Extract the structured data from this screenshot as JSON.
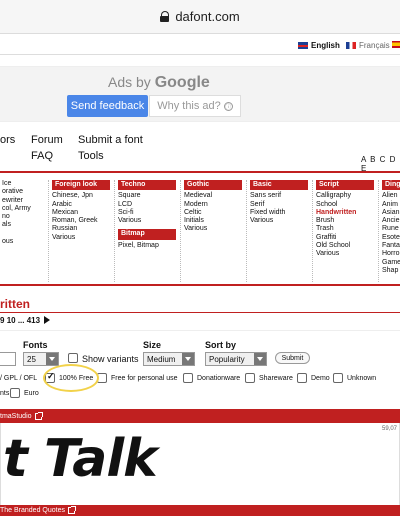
{
  "browser": {
    "url": "dafont.com"
  },
  "languages": {
    "english": "English",
    "francais": "Français"
  },
  "ads": {
    "ads_by": "Ads by",
    "google": "Google",
    "feedback_button": "Send feedback",
    "why_button": "Why this ad?",
    "info_glyph": "ⓘ"
  },
  "nav": {
    "authors": "ors",
    "forum": "Forum",
    "submit": "Submit a font",
    "faq": "FAQ",
    "tools": "Tools",
    "alphabet": "A B C D E"
  },
  "categories": {
    "fancy_partial": [
      "Ice",
      "orative",
      "ewriter",
      "col, Army",
      "no",
      "als",
      "",
      "ous"
    ],
    "foreign": {
      "title": "Foreign look",
      "items": [
        "Chinese, Jpn",
        "Arabic",
        "Mexican",
        "Roman, Greek",
        "Russian",
        "Various"
      ]
    },
    "techno": {
      "title": "Techno",
      "items": [
        "Square",
        "LCD",
        "Sci-fi",
        "Various"
      ]
    },
    "bitmap": {
      "title": "Bitmap",
      "items": [
        "Pixel, Bitmap"
      ]
    },
    "gothic": {
      "title": "Gothic",
      "items": [
        "Medieval",
        "Modern",
        "Celtic",
        "Initials",
        "Various"
      ]
    },
    "basic": {
      "title": "Basic",
      "items": [
        "Sans serif",
        "Serif",
        "Fixed width",
        "Various"
      ]
    },
    "script": {
      "title": "Script",
      "items": [
        "Calligraphy",
        "School",
        "Handwritten",
        "Brush",
        "Trash",
        "Graffiti",
        "Old School",
        "Various"
      ],
      "selected": "Handwritten"
    },
    "dingbats": {
      "title": "Ding",
      "items": [
        "Alien",
        "Anim",
        "Asian",
        "Ancie",
        "Rune",
        "Esote",
        "Fanta",
        "Horro",
        "Game",
        "Shap"
      ]
    }
  },
  "listing": {
    "title": "ritten",
    "pager": {
      "pages": [
        "9",
        "10",
        "...",
        "413"
      ]
    }
  },
  "filters": {
    "fonts_label": "Fonts",
    "fonts_value": "25",
    "show_variants": "Show variants",
    "size_label": "Size",
    "size_value": "Medium",
    "sort_label": "Sort by",
    "sort_value": "Popularity",
    "submit": "Submit",
    "license_partial": "/ GPL / OFL",
    "free100": "100% Free",
    "personal": "Free for personal use",
    "donationware": "Donationware",
    "shareware": "Shareware",
    "demo": "Demo",
    "unknown": "Unknown",
    "fonts_partial": "nts",
    "euro": "Euro"
  },
  "fonts": [
    {
      "author": "tmaStudio",
      "sample": "t Talk",
      "downloads": "59,07"
    },
    {
      "author": "The Branded Quotes"
    }
  ],
  "colors": {
    "brand_red": "#c02020",
    "google_blue": "#4a86e8",
    "highlight": "#f2d24a"
  }
}
